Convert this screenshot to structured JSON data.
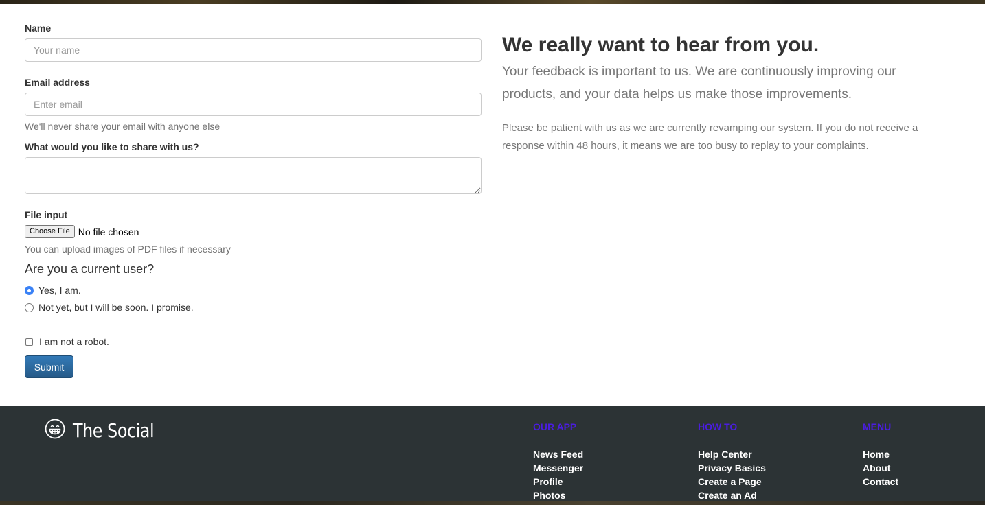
{
  "form": {
    "name_label": "Name",
    "name_placeholder": "Your name",
    "email_label": "Email address",
    "email_placeholder": "Enter email",
    "email_help": "We'll never share your email with anyone else",
    "message_label": "What would you like to share with us?",
    "file_label": "File input",
    "file_button": "Choose File",
    "file_status": "No file chosen",
    "file_help": "You can upload images of PDF files if necessary",
    "user_question": "Are you a current user?",
    "radio_options": [
      "Yes, I am.",
      "Not yet, but I will be soon. I promise."
    ],
    "robot_label": "I am not a robot.",
    "submit_label": "Submit"
  },
  "info": {
    "headline": "We really want to hear from you.",
    "lead": "Your feedback is important to us. We are continuously improving our products, and your data helps us make those improvements.",
    "paragraph": "Please be patient with us as we are currently revamping our system. If you do not receive a response within 48 hours, it means we are too busy to replay to your complaints."
  },
  "footer": {
    "brand": "The Social",
    "columns": [
      {
        "heading": "OUR APP",
        "links": [
          "News Feed",
          "Messenger",
          "Profile",
          "Photos"
        ]
      },
      {
        "heading": "HOW TO",
        "links": [
          "Help Center",
          "Privacy Basics",
          "Create a Page",
          "Create an Ad"
        ]
      },
      {
        "heading": "MENU",
        "links": [
          "Home",
          "About",
          "Contact"
        ]
      }
    ]
  },
  "colors": {
    "accent": "#337ab7",
    "footer_bg": "#2c3335",
    "footer_heading": "#4b1de0",
    "radio_checked": "#3b82f6"
  }
}
